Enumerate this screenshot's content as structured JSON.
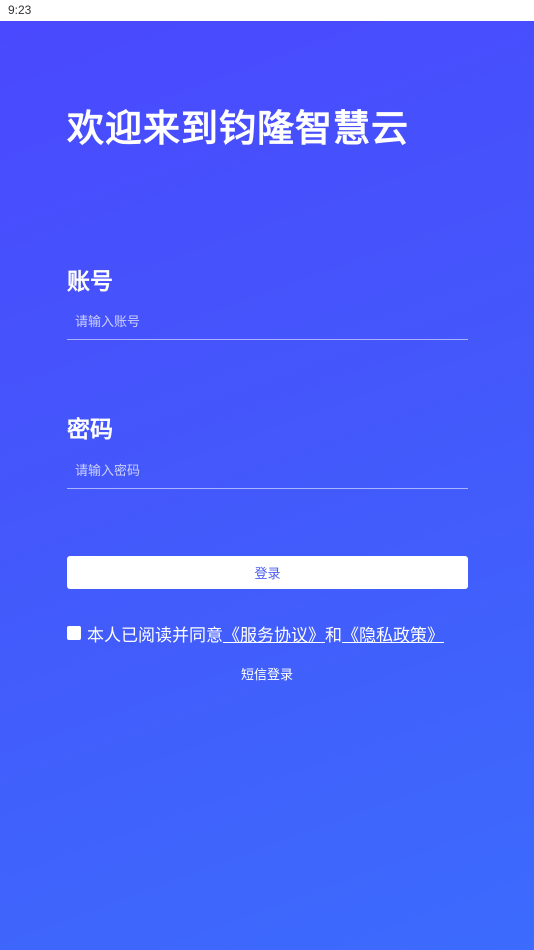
{
  "status_bar": {
    "time": "9:23"
  },
  "header": {
    "title": "欢迎来到钧隆智慧云"
  },
  "form": {
    "account": {
      "label": "账号",
      "placeholder": "请输入账号",
      "value": ""
    },
    "password": {
      "label": "密码",
      "placeholder": "请输入密码",
      "value": ""
    },
    "login_label": "登录"
  },
  "agreement": {
    "checked": false,
    "prefix": "本人已阅读并同意",
    "service_link": "《服务协议》",
    "connector": "和",
    "privacy_link": "《隐私政策》"
  },
  "sms_login_label": "短信登录",
  "colors": {
    "background_start": "#4a48ff",
    "background_end": "#3c6bfd",
    "button_text": "#4a5cf0",
    "text": "#ffffff"
  }
}
